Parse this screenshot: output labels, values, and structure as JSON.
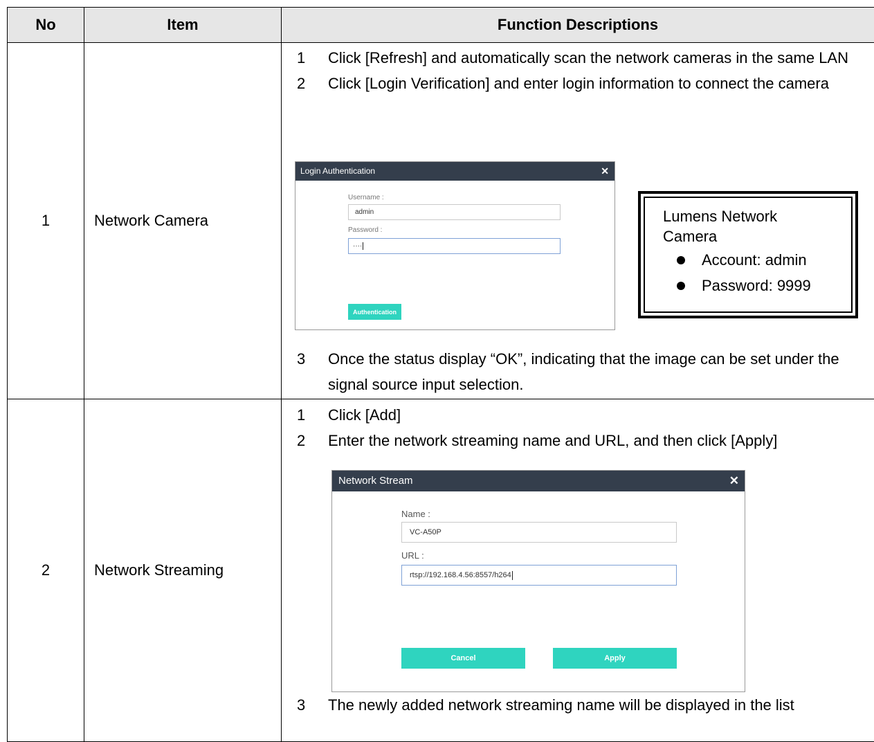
{
  "table": {
    "headers": {
      "no": "No",
      "item": "Item",
      "desc": "Function Descriptions"
    },
    "rows": [
      {
        "no": "1",
        "item": "Network Camera",
        "steps": [
          {
            "num": "1",
            "text": "Click [Refresh] and automatically scan the network cameras in the same LAN"
          },
          {
            "num": "2",
            "text": "Click [Login Verification] and enter login information to connect the camera"
          },
          {
            "num": "3",
            "text": "Once the status display “OK”, indicating that the image can be set under the signal source input selection."
          }
        ],
        "dialog": {
          "title": "Login Authentication",
          "close": "✕",
          "username_label": "Username :",
          "username_value": "admin",
          "password_label": "Password :",
          "password_value": "····",
          "button": "Authentication"
        },
        "info": {
          "title": "Lumens Network Camera",
          "bullets": [
            "Account: admin",
            "Password: 9999"
          ]
        }
      },
      {
        "no": "2",
        "item": "Network Streaming",
        "steps": [
          {
            "num": "1",
            "text": "Click [Add]"
          },
          {
            "num": "2",
            "text": "Enter the network streaming name and URL, and then click [Apply]"
          },
          {
            "num": "3",
            "text": "The newly added network streaming name will be displayed in the list"
          }
        ],
        "dialog": {
          "title": "Network Stream",
          "close": "✕",
          "name_label": "Name :",
          "name_value": "VC-A50P",
          "url_label": "URL :",
          "url_value": "rtsp://192.168.4.56:8557/h264",
          "cancel": "Cancel",
          "apply": "Apply"
        }
      }
    ]
  }
}
